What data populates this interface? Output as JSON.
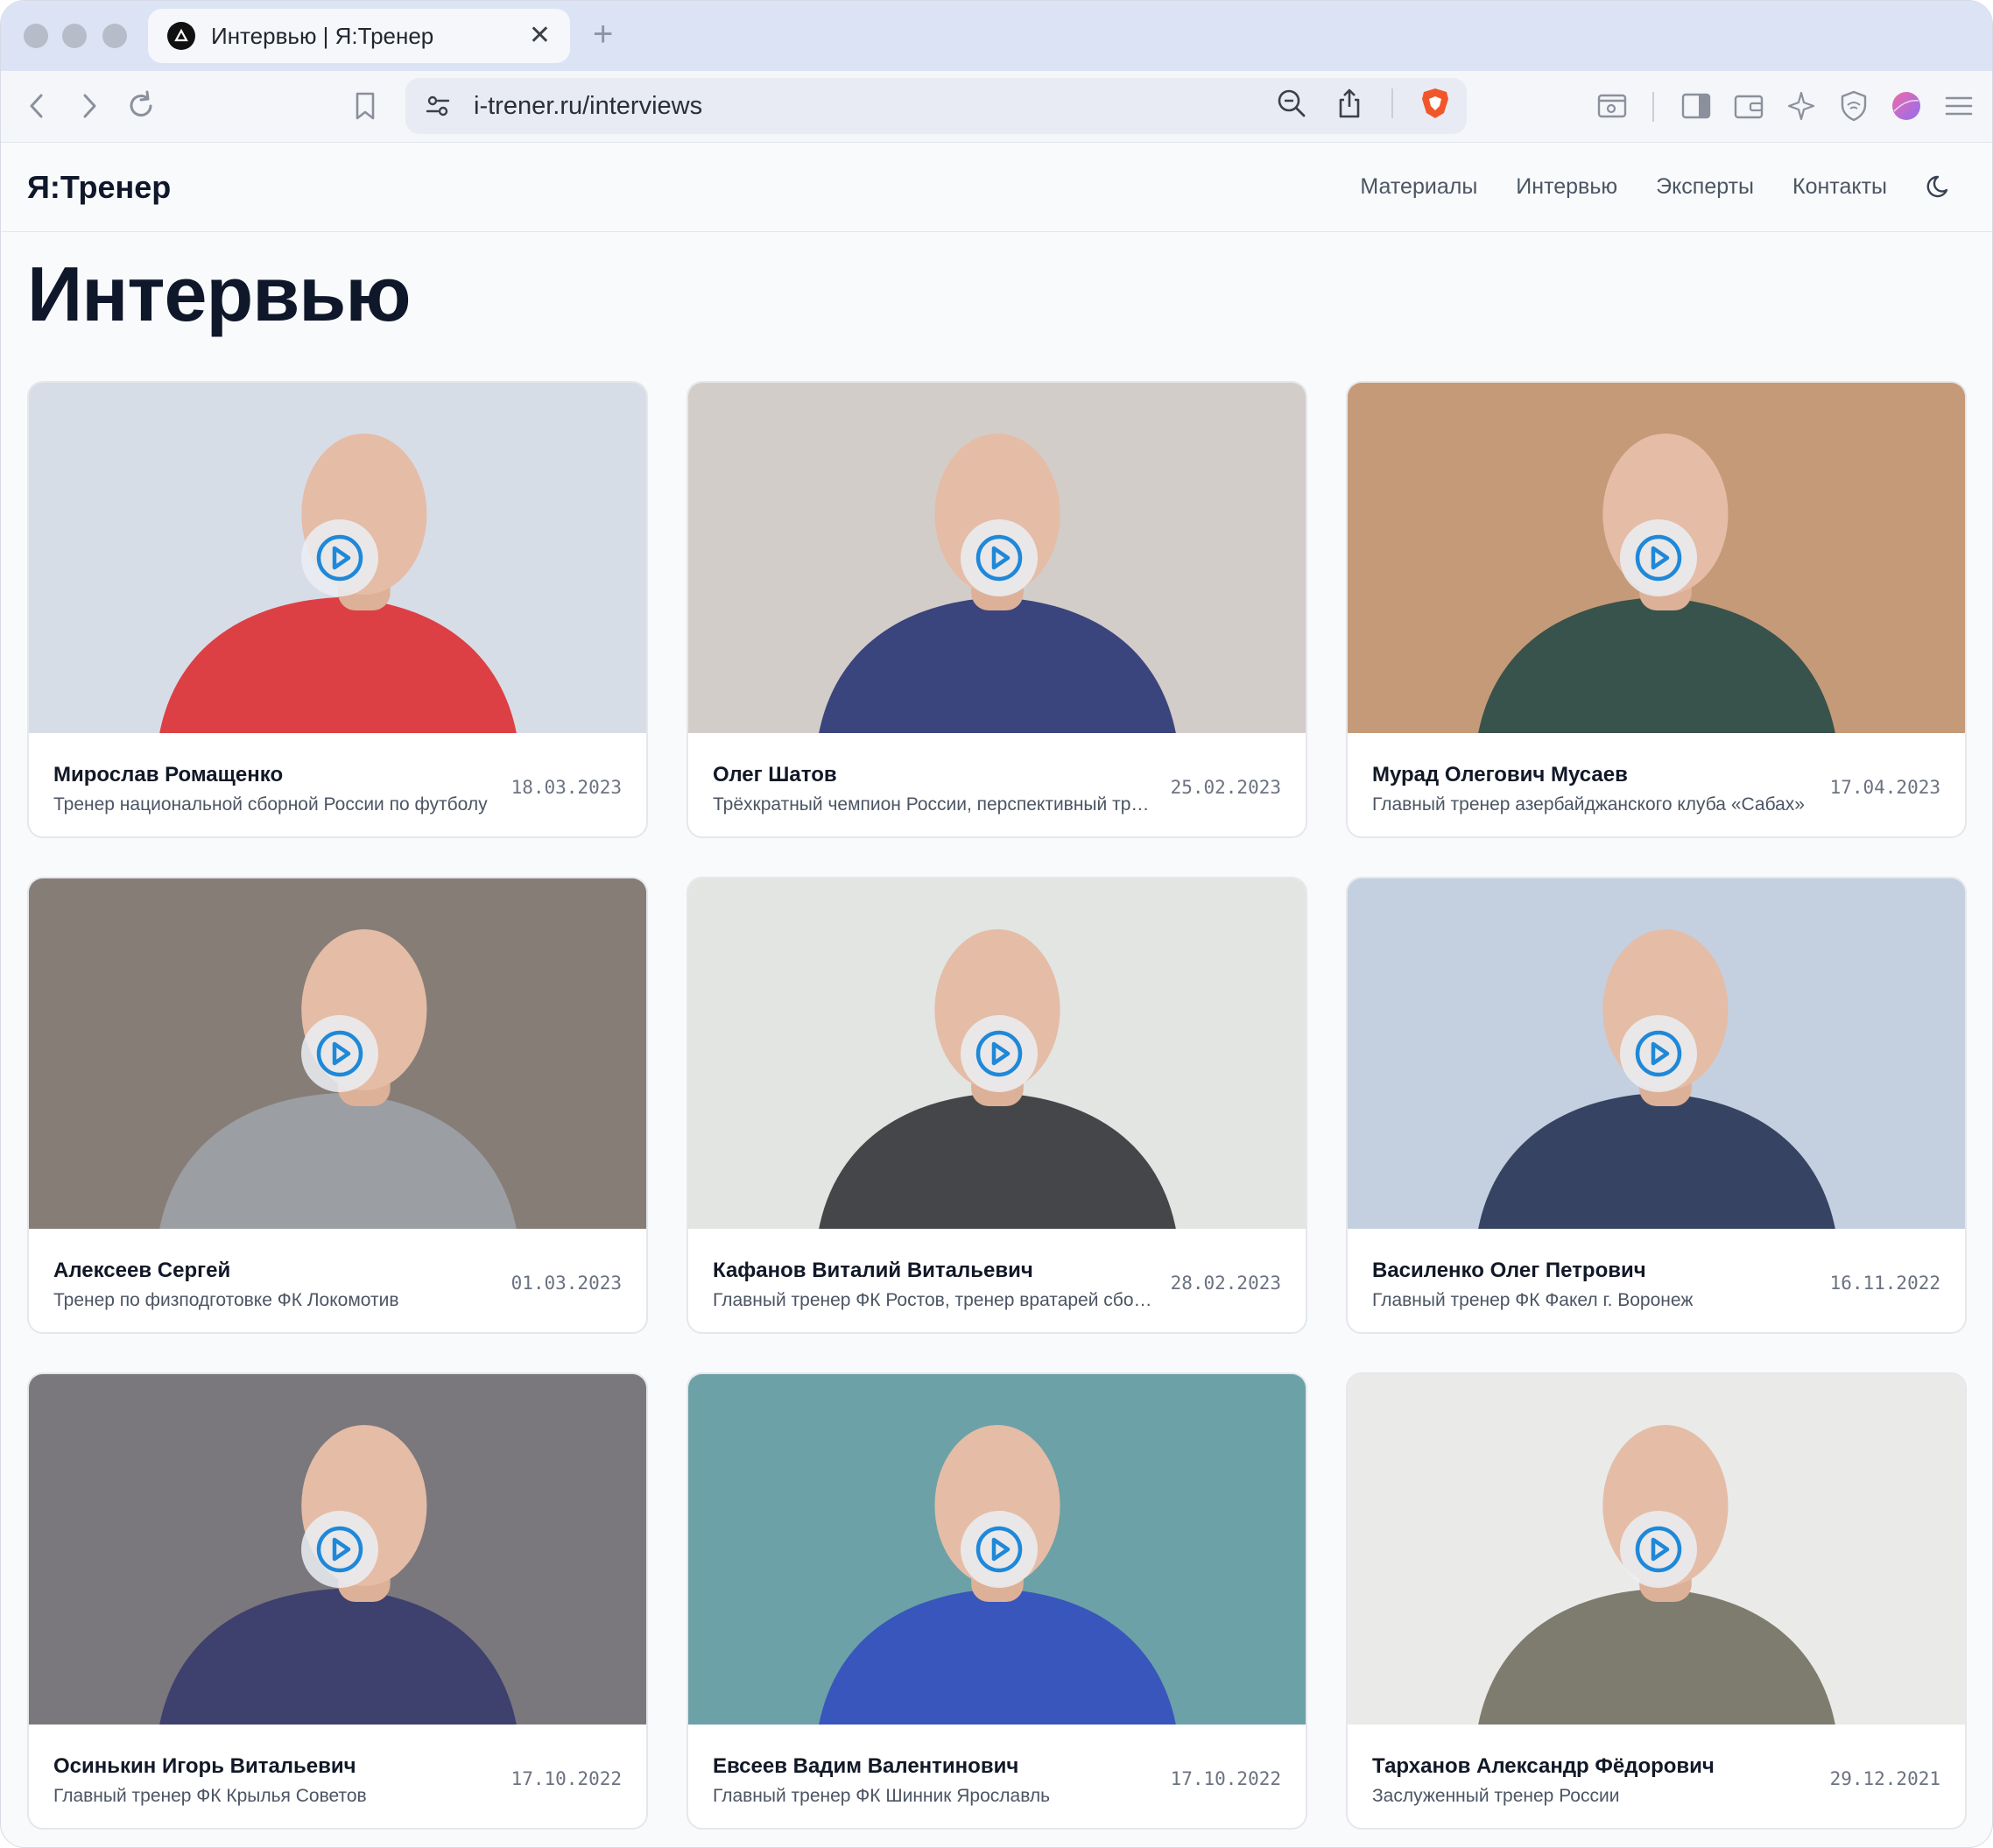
{
  "browser": {
    "tab_title": "Интервью | Я:Тренер",
    "url": "i-trener.ru/interviews"
  },
  "site": {
    "logo": "Я:Тренер",
    "nav": [
      {
        "label": "Материалы"
      },
      {
        "label": "Интервью"
      },
      {
        "label": "Эксперты"
      },
      {
        "label": "Контакты"
      }
    ],
    "theme_icon": "moon-icon"
  },
  "page": {
    "title": "Интервью"
  },
  "interviews": [
    {
      "name": "Мирослав Ромащенко",
      "desc": "Тренер национальной сборной России по футболу",
      "date": "18.03.2023",
      "thumb_bg": "#cfd6e2",
      "shirt": "#d8262b"
    },
    {
      "name": "Олег Шатов",
      "desc": "Трёхкратный чемпион России, перспективный тренер",
      "date": "25.02.2023",
      "thumb_bg": "#c9c2bd",
      "shirt": "#1f2b6b"
    },
    {
      "name": "Мурад Олегович Мусаев",
      "desc": "Главный тренер азербайджанского клуба «Сабах»",
      "date": "17.04.2023",
      "thumb_bg": "#b9835a",
      "shirt": "#1d3b34"
    },
    {
      "name": "Алексеев Сергей",
      "desc": "Тренер по физподготовке ФК Локомотив",
      "date": "01.03.2023",
      "thumb_bg": "#6b5f58",
      "shirt": "#8e9196"
    },
    {
      "name": "Кафанов Виталий Витальевич",
      "desc": "Главный тренер ФК Ростов, тренер вратарей сборной",
      "date": "28.02.2023",
      "thumb_bg": "#dde0dc",
      "shirt": "#2b2d31"
    },
    {
      "name": "Василенко Олег Петрович",
      "desc": "Главный тренер ФК Факел г. Воронеж",
      "date": "16.11.2022",
      "thumb_bg": "#b7c6d8",
      "shirt": "#1c2a4d"
    },
    {
      "name": "Осинькин Игорь Витальевич",
      "desc": "Главный тренер ФК Крылья Советов",
      "date": "17.10.2022",
      "thumb_bg": "#5c5a60",
      "shirt": "#24265a"
    },
    {
      "name": "Евсеев Вадим Валентинович",
      "desc": "Главный тренер ФК Шинник Ярославль",
      "date": "17.10.2022",
      "thumb_bg": "#4a8b93",
      "shirt": "#1d3fb3"
    },
    {
      "name": "Тарханов Александр Фёдорович",
      "desc": "Заслуженный тренер России",
      "date": "29.12.2021",
      "thumb_bg": "#e7e6e3",
      "shirt": "#6c6a5c"
    }
  ],
  "colors": {
    "play_icon": "#1e88d9",
    "text_primary": "#111827",
    "text_muted": "#4b5563"
  }
}
